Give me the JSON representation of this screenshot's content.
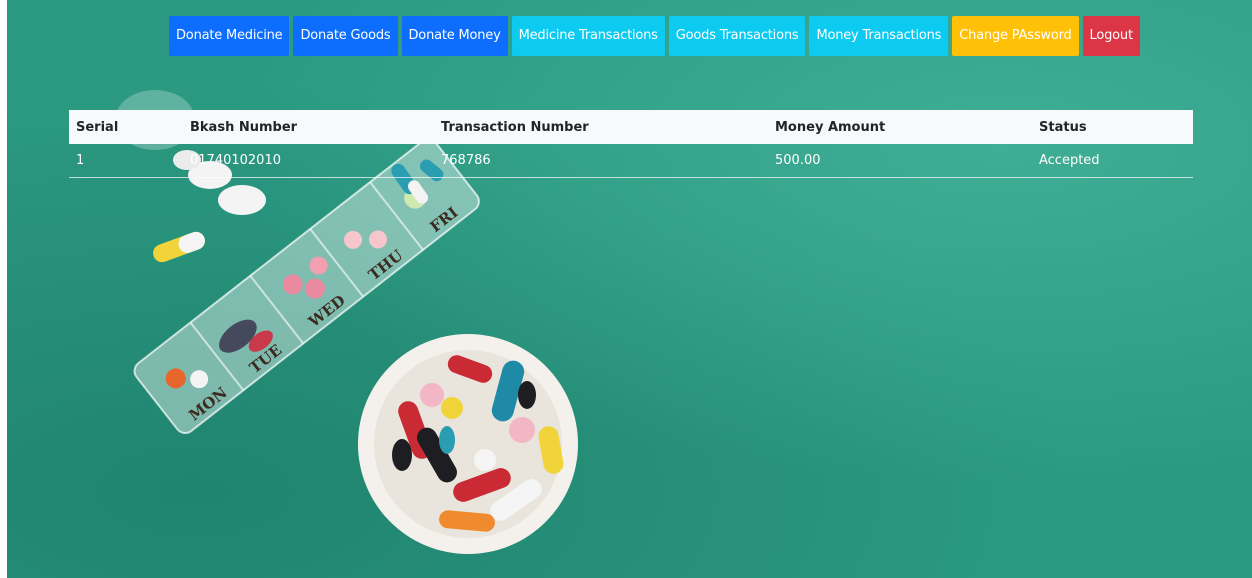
{
  "nav": {
    "items": [
      {
        "label": "Donate Medicine",
        "variant": "primary",
        "color": "#0d6efd"
      },
      {
        "label": "Donate Goods",
        "variant": "primary",
        "color": "#0d6efd"
      },
      {
        "label": "Donate Money",
        "variant": "primary",
        "color": "#0d6efd"
      },
      {
        "label": "Medicine Transactions",
        "variant": "info",
        "color": "#0dcaf0"
      },
      {
        "label": "Goods Transactions",
        "variant": "info",
        "color": "#0dcaf0"
      },
      {
        "label": "Money Transactions",
        "variant": "info",
        "color": "#0dcaf0"
      },
      {
        "label": "Change PAssword",
        "variant": "warning",
        "color": "#ffc107"
      },
      {
        "label": "Logout",
        "variant": "danger",
        "color": "#dc3545"
      }
    ]
  },
  "table": {
    "headers": {
      "serial": "Serial",
      "bkash": "Bkash Number",
      "transaction": "Transaction Number",
      "amount": "Money Amount",
      "status": "Status"
    },
    "rows": [
      {
        "serial": "1",
        "bkash": "01740102010",
        "transaction": "768786",
        "amount": "500.00",
        "status": "Accepted"
      }
    ]
  },
  "background": {
    "color": "#2c9a82",
    "pill_box_days": [
      "MON",
      "TUE",
      "WED",
      "THU",
      "FRI"
    ]
  }
}
